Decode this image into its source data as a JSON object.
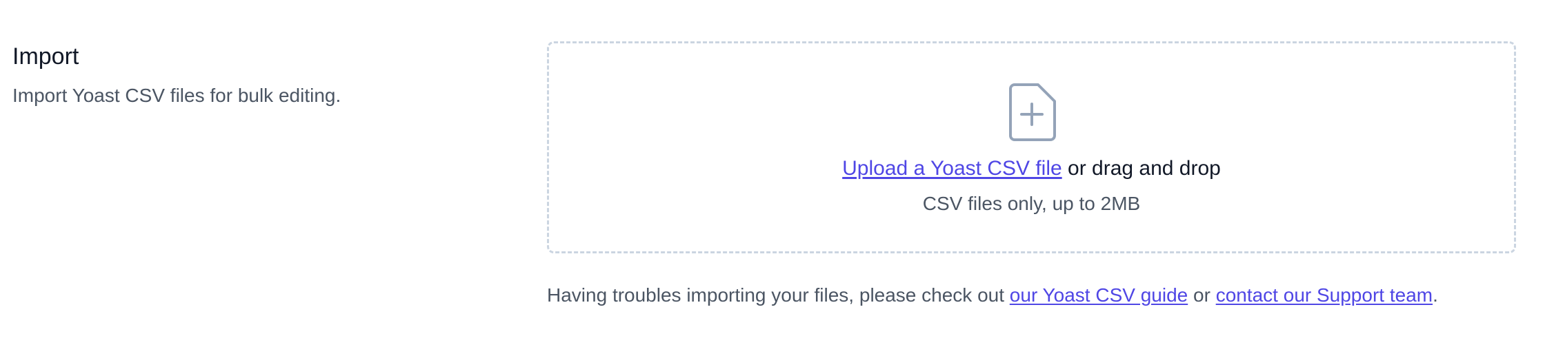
{
  "import_section": {
    "title": "Import",
    "description": "Import Yoast CSV files for bulk editing."
  },
  "dropzone": {
    "icon": "file-plus-icon",
    "upload_link": "Upload a Yoast CSV file",
    "upload_suffix": " or drag and drop",
    "hint": "CSV files only, up to 2MB"
  },
  "help": {
    "prefix": "Having troubles importing your files, please check out ",
    "guide_link": "our Yoast CSV guide",
    "middle": " or ",
    "support_link": "contact our Support team",
    "suffix": "."
  },
  "colors": {
    "link": "#4f46e5",
    "muted_text": "#4b5563",
    "heading_text": "#111827",
    "dashed_border": "#cbd5e1",
    "icon_stroke": "#94a3b8"
  }
}
